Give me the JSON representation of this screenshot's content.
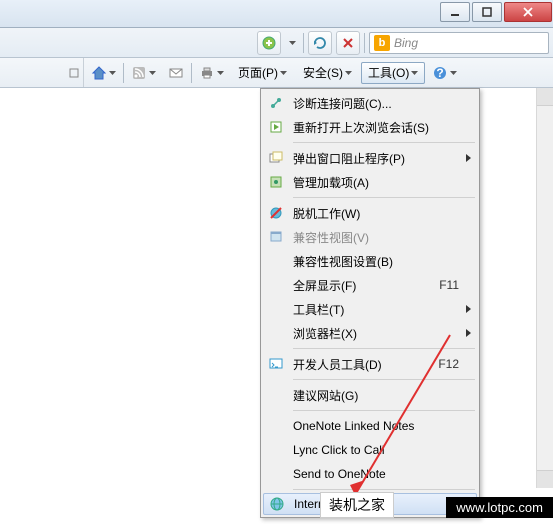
{
  "search": {
    "engine_name": "Bing",
    "engine_letter": "b"
  },
  "toolbar": {
    "page": "页面(P)",
    "safety": "安全(S)",
    "tools": "工具(O)"
  },
  "menu": {
    "diagnose": "诊断连接问题(C)...",
    "reopen": "重新打开上次浏览会话(S)",
    "popup": "弹出窗口阻止程序(P)",
    "addons": "管理加载项(A)",
    "offline": "脱机工作(W)",
    "compat_view": "兼容性视图(V)",
    "compat_settings": "兼容性视图设置(B)",
    "fullscreen": "全屏显示(F)",
    "fullscreen_key": "F11",
    "toolbars": "工具栏(T)",
    "explorer_bars": "浏览器栏(X)",
    "devtools": "开发人员工具(D)",
    "devtools_key": "F12",
    "suggested": "建议网站(G)",
    "onenote_linked": "OneNote Linked Notes",
    "lync": "Lync Click to Call",
    "send_onenote": "Send to OneNote",
    "internet": "Internet"
  },
  "watermark": {
    "text1": "装机之家",
    "text2": "www.lotpc.com"
  }
}
